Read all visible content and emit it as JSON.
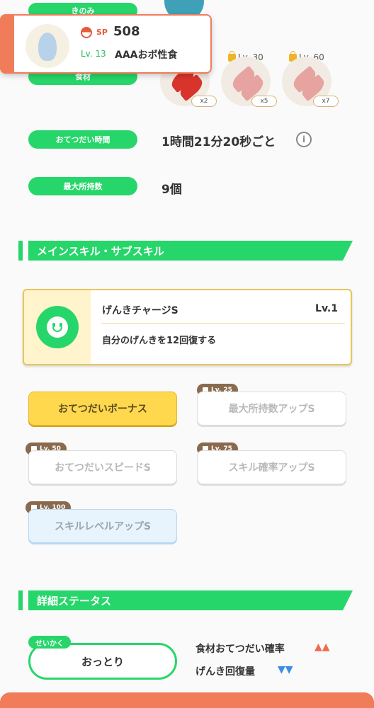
{
  "labels": {
    "berry": "きのみ",
    "ingredients": "食材",
    "help_time": "おてつだい時間",
    "max_carry": "最大所持数"
  },
  "values": {
    "help_time": "1時間21分20秒ごと",
    "max_carry": "9個"
  },
  "ingredients": [
    {
      "level": "",
      "count": "x2"
    },
    {
      "level": "Lv. 30",
      "count": "x5"
    },
    {
      "level": "Lv. 60",
      "count": "x7"
    }
  ],
  "popup": {
    "sp_label": "SP",
    "sp_value": "508",
    "level": "Lv. 13",
    "name": "AAAおボ性食"
  },
  "section_skills": "メインスキル・サブスキル",
  "main_skill": {
    "name": "げんきチャージS",
    "level": "Lv.1",
    "description": "自分のげんきを12回復する"
  },
  "sub_skills": [
    {
      "label": "おてつだいボーナス",
      "unlock": ""
    },
    {
      "label": "最大所持数アップS",
      "unlock": "Lv. 25"
    },
    {
      "label": "おてつだいスピードS",
      "unlock": "Lv. 50"
    },
    {
      "label": "スキル確率アップS",
      "unlock": "Lv. 75"
    },
    {
      "label": "スキルレベルアップS",
      "unlock": "Lv. 100"
    }
  ],
  "section_status": "詳細ステータス",
  "nature": {
    "tag": "せいかく",
    "value": "おっとり",
    "up_stat": "食材おてつだい確率",
    "up_marks": "▲▲",
    "down_stat": "げんき回復量",
    "down_marks": "▼▼"
  },
  "colors": {
    "accent_green": "#27d66a",
    "accent_orange": "#f07c5a",
    "up": "#f06a4c",
    "down": "#3a8fe0"
  }
}
